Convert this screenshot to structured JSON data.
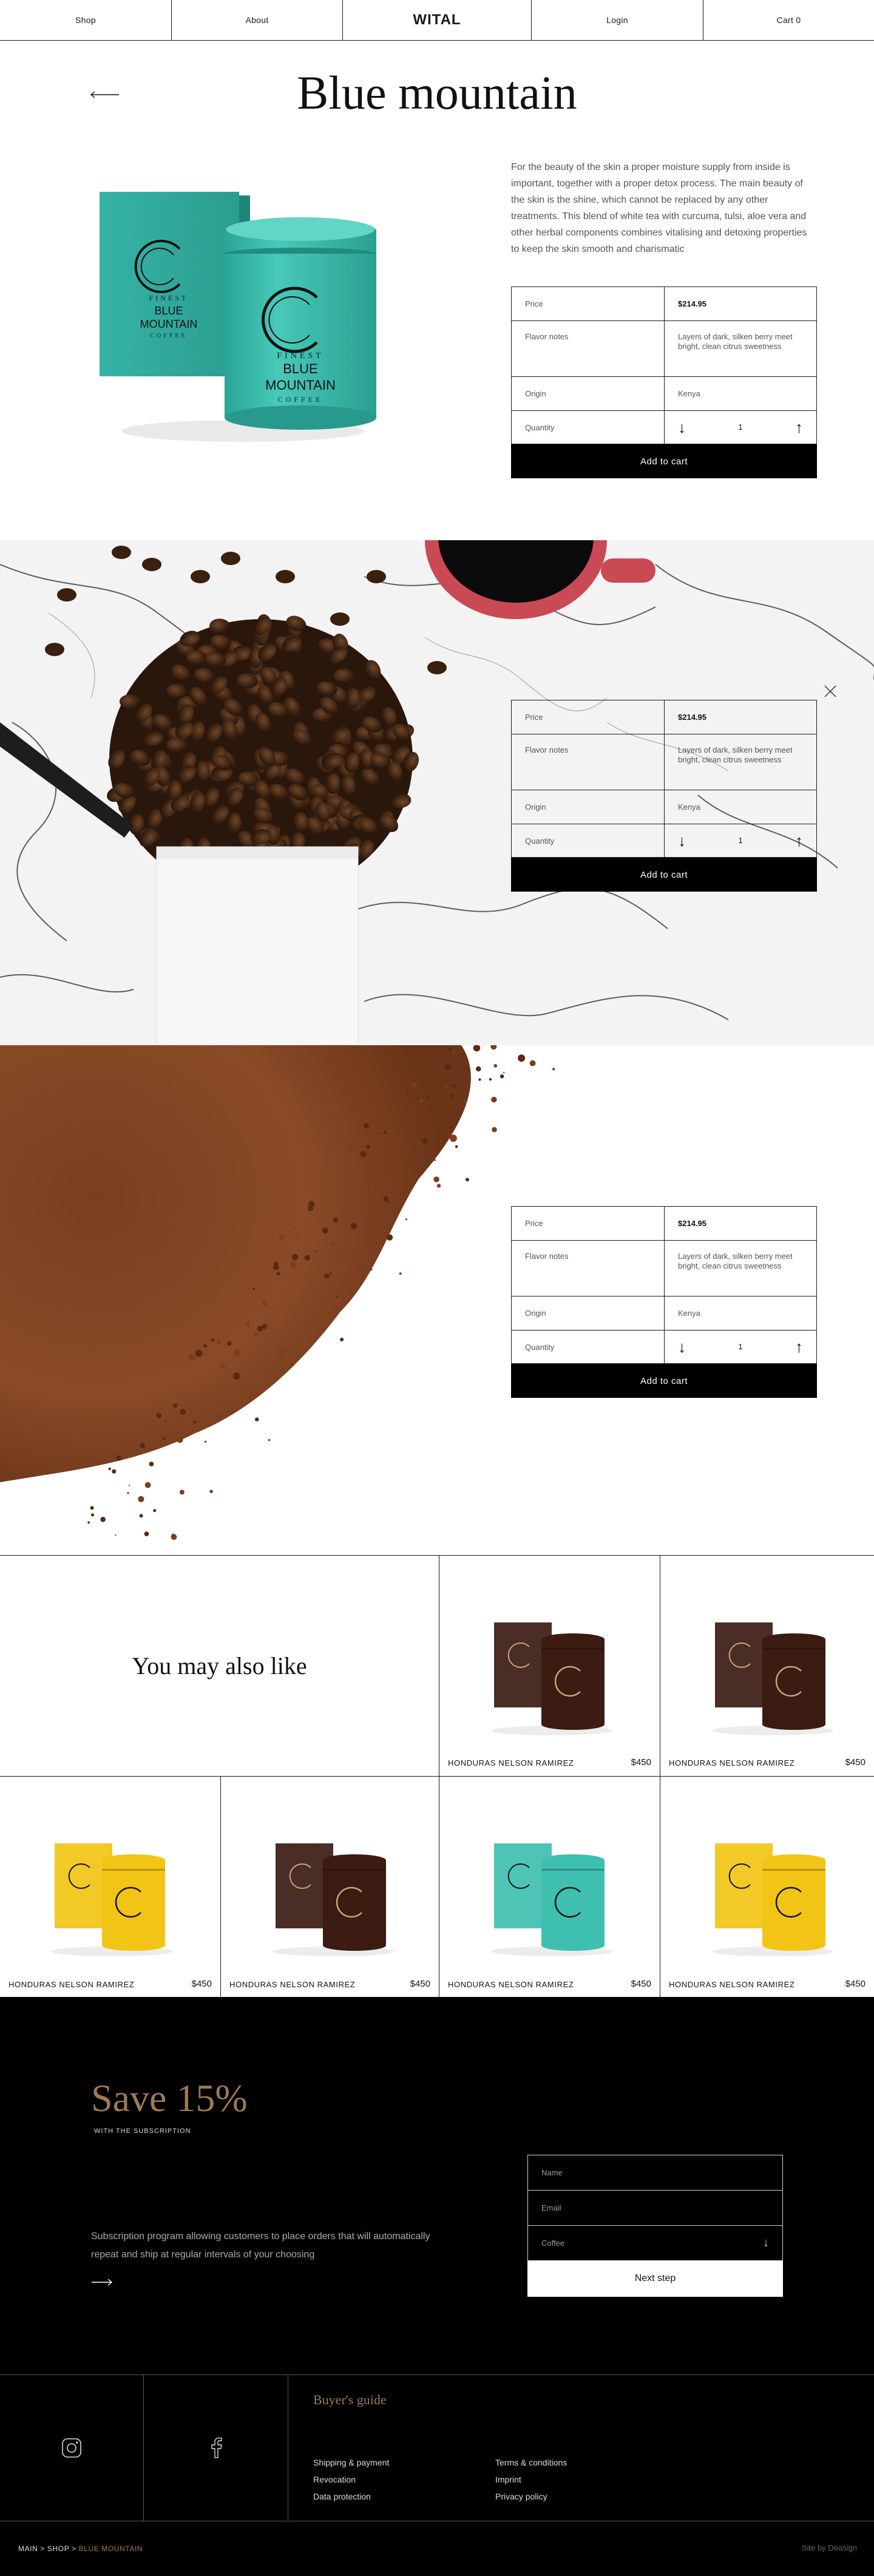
{
  "nav": {
    "shop": "Shop",
    "about": "About",
    "brand": "WITAL",
    "login": "Login",
    "cart": "Cart 0"
  },
  "product": {
    "title": "Blue mountain",
    "description": "For the beauty of the skin a proper moisture supply from inside is important, together with a proper detox process. The main beauty of the skin is the shine, which cannot be replaced by any other treatments. This blend of white tea with curcuma, tulsi, aloe vera and other herbal components combines vitalising and detoxing properties to keep the skin smooth and charismatic",
    "packaging": {
      "line1": "FINEST",
      "line2": "BLUE",
      "line3": "MOUNTAIN",
      "line4": "COFFEE",
      "accent_color": "#3fbfb0"
    },
    "info": {
      "price_label": "Price",
      "price_value": "$214.95",
      "flavor_label": "Flavor notes",
      "flavor_value": "Layers of dark, silken berry meet bright, clean citrus sweetness",
      "origin_label": "Origin",
      "origin_value": "Kenya",
      "quantity_label": "Quantity",
      "quantity_value": "1",
      "add_to_cart": "Add to cart"
    }
  },
  "recommendations": {
    "heading": "You may also like",
    "items": [
      {
        "name": "HONDURAS NELSON RAMIREZ",
        "price": "$450",
        "color": "#3b1b12"
      },
      {
        "name": "HONDURAS NELSON RAMIREZ",
        "price": "$450",
        "color": "#3b1b12"
      },
      {
        "name": "HONDURAS NELSON RAMIREZ",
        "price": "$450",
        "color": "#f2c416"
      },
      {
        "name": "HONDURAS NELSON RAMIREZ",
        "price": "$450",
        "color": "#3b1b12"
      },
      {
        "name": "HONDURAS NELSON RAMIREZ",
        "price": "$450",
        "color": "#3fbfb0"
      },
      {
        "name": "HONDURAS NELSON RAMIREZ",
        "price": "$450",
        "color": "#f2c416"
      }
    ]
  },
  "subscription": {
    "title": "Save 15%",
    "subtitle": "WITH THE SUBSCRIPTION",
    "text": "Subscription program allowing customers to place orders that will automatically repeat and ship at regular intervals of your choosing",
    "name_placeholder": "Name",
    "email_placeholder": "Email",
    "coffee_select": "Coffee",
    "next_step": "Next step",
    "accent_color": "#9e7a55"
  },
  "footer": {
    "guide_title": "Buyer's guide",
    "links_left": [
      "Shipping & payment",
      "Revocation",
      "Data protection"
    ],
    "links_right": [
      "Terms & conditions",
      "Imprint",
      "Privacy policy"
    ],
    "breadcrumb_main": "MAIN",
    "breadcrumb_shop": "SHOP",
    "breadcrumb_current": "BLUE MOUNTAIN",
    "breadcrumb_sep": ">",
    "credit": "Site by Deasign"
  }
}
